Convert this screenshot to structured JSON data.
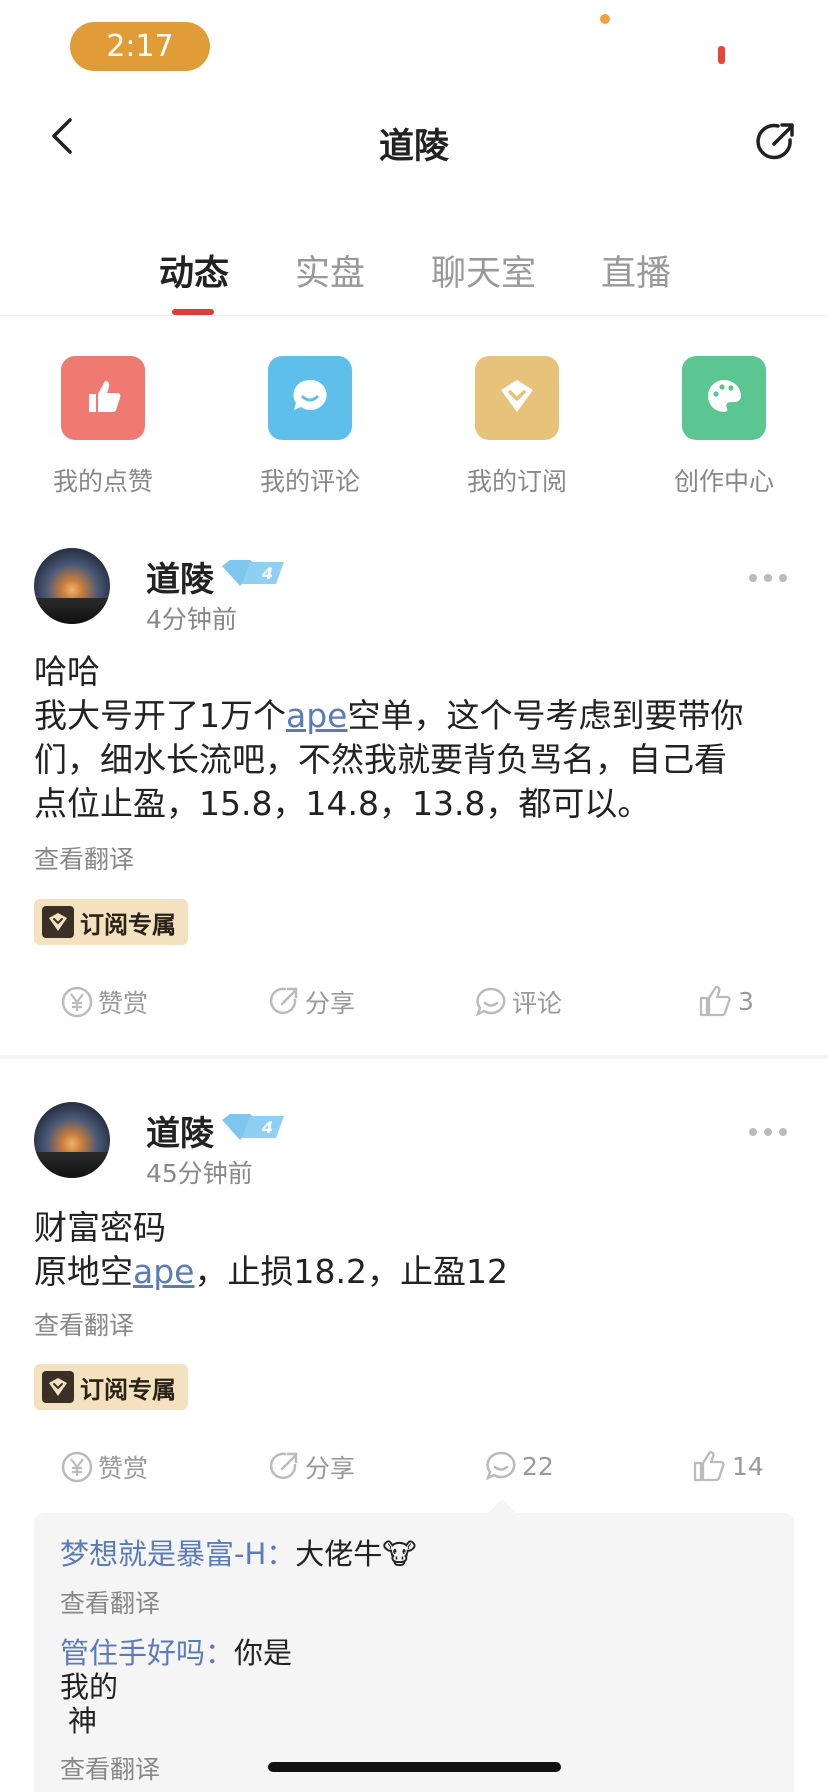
{
  "status_bar": {
    "time": "2:17"
  },
  "header": {
    "title": "道陵"
  },
  "tabs": [
    {
      "label": "动态",
      "active": true
    },
    {
      "label": "实盘",
      "active": false
    },
    {
      "label": "聊天室",
      "active": false
    },
    {
      "label": "直播",
      "active": false
    }
  ],
  "quick_actions": [
    {
      "label": "我的点赞",
      "icon": "thumbs-up-icon",
      "color": "#ee7a72"
    },
    {
      "label": "我的评论",
      "icon": "comment-icon",
      "color": "#5ec0ea"
    },
    {
      "label": "我的订阅",
      "icon": "subscribe-icon",
      "color": "#e6c27a"
    },
    {
      "label": "创作中心",
      "icon": "palette-icon",
      "color": "#5cc692"
    }
  ],
  "posts": [
    {
      "author": "道陵",
      "time": "4分钟前",
      "line1": "哈哈",
      "line2_before": "我大号开了1万个",
      "line2_link": "ape",
      "line2_after": "空单，这个号考虑到要带你",
      "line3": "们，细水长流吧，不然我就要背负骂名，自己看",
      "line4": "点位止盈，15.8，14.8，13.8，都可以。",
      "translate": "查看翻译",
      "tag": "订阅专属",
      "actions": {
        "reward": "赞赏",
        "share": "分享",
        "comment": "评论",
        "likes": "3"
      }
    },
    {
      "author": "道陵",
      "time": "45分钟前",
      "line1": "财富密码",
      "line2_before": "原地空",
      "line2_link": "ape",
      "line2_after": "，止损18.2，止盈12",
      "translate": "查看翻译",
      "tag": "订阅专属",
      "actions": {
        "reward": "赞赏",
        "share": "分享",
        "comment": "22",
        "likes": "14"
      }
    }
  ],
  "comments": [
    {
      "author": "梦想就是暴富-H：",
      "text": "大佬牛🐮",
      "translate": "查看翻译"
    },
    {
      "author": "管住手好吗：",
      "text_line1": "你是",
      "text_line2": "我的",
      "text_line3": "神",
      "translate": "查看翻译"
    }
  ],
  "colors": {
    "accent": "#e23a3a",
    "link": "#5b7cb8",
    "status_time_bg": "#e09c36"
  }
}
